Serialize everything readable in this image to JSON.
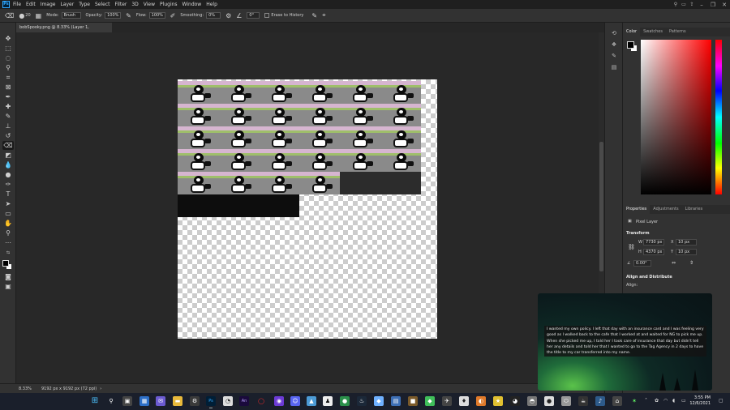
{
  "app": {
    "menus": [
      "File",
      "Edit",
      "Image",
      "Layer",
      "Type",
      "Select",
      "Filter",
      "3D",
      "View",
      "Plugins",
      "Window",
      "Help"
    ],
    "logo_text": "Ps"
  },
  "options_bar": {
    "brush_size": "20",
    "mode_label": "Mode:",
    "mode_value": "Brush",
    "opacity_label": "Opacity:",
    "opacity_value": "100%",
    "flow_label": "Flow:",
    "flow_value": "100%",
    "smoothing_label": "Smoothing:",
    "smoothing_value": "0%",
    "angle_value": "0°",
    "erase_history_label": "Erase to History"
  },
  "document": {
    "tab_title": "bobSpooky.png @ 8.33% (Layer 1, RGB/8#)",
    "close_symbol": "×"
  },
  "status": {
    "zoom": "8.33%",
    "doc_info": "9192 px x 9192 px (72 ppi)"
  },
  "color_panel": {
    "tabs": [
      "Color",
      "Swatches",
      "Patterns"
    ]
  },
  "properties_panel": {
    "tabs": [
      "Properties",
      "Adjustments",
      "Libraries"
    ],
    "layer_type": "Pixel Layer",
    "transform_heading": "Transform",
    "w_label": "W",
    "w_value": "7730 px",
    "h_label": "H",
    "h_value": "4370 px",
    "x_label": "X",
    "x_value": "10 px",
    "y_label": "Y",
    "y_value": "10 px",
    "angle_value": "0.00°",
    "align_heading": "Align and Distribute",
    "align_label": "Align:"
  },
  "notification": {
    "text": "I wanted my own policy. I left that day with an insurance card and I was feeling very good as I walked back to the cafe that I worked at and waited for NG to pick me up. When she picked me up, I told her I took care of insurance that day but didn't tell her any details and told her that I wanted to go to the Tag Agency in 2 days to have the title to my car transferred into my name."
  },
  "taskbar": {
    "time": "3:55 PM",
    "date": "12/6/2021"
  },
  "colors": {
    "accent": "#31a8ff",
    "foreground": "#000000",
    "background": "#ffffff"
  }
}
